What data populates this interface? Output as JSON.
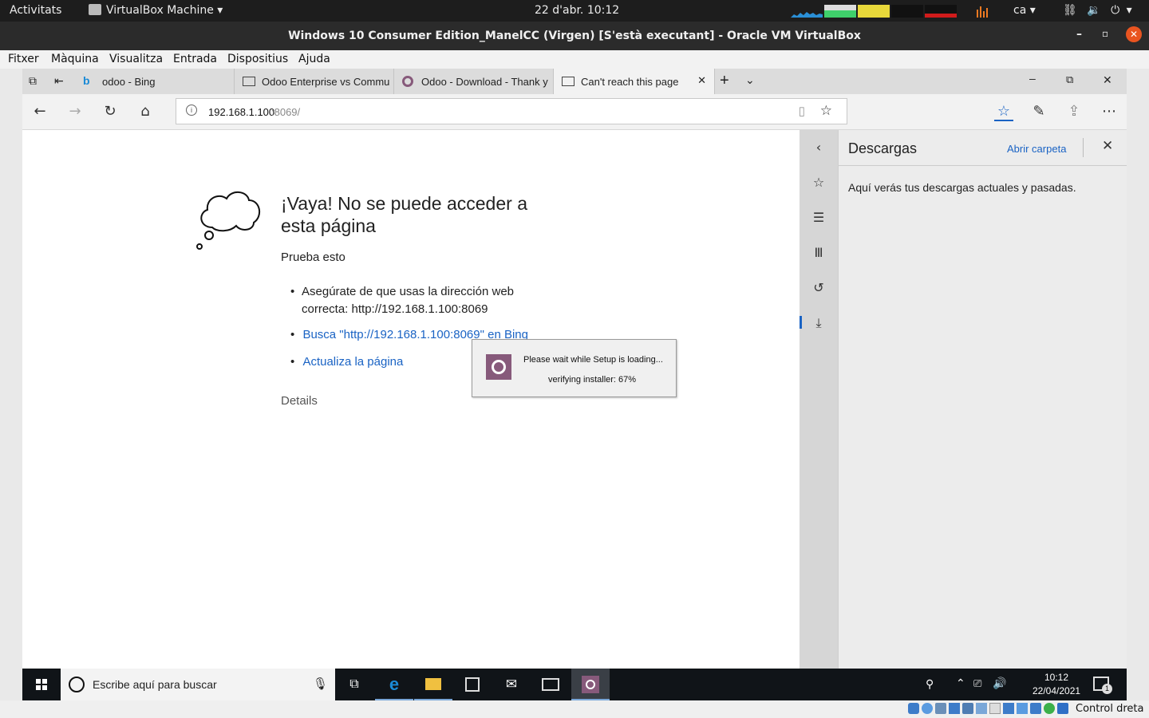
{
  "gnome": {
    "activities": "Activitats",
    "app_name": "VirtualBox Machine",
    "clock": "22 d'abr.  10:12",
    "lang": "ca"
  },
  "vbox": {
    "title": "Windows 10 Consumer Edition_ManelCC (Virgen) [S'està executant] - Oracle VM VirtualBox",
    "menu": [
      "Fitxer",
      "Màquina",
      "Visualitza",
      "Entrada",
      "Dispositius",
      "Ajuda"
    ],
    "status_key": "Control dreta"
  },
  "edge": {
    "tabs": [
      {
        "label": "odoo - Bing",
        "icon": "bing-icon"
      },
      {
        "label": "Odoo Enterprise vs Commu",
        "icon": "page-icon"
      },
      {
        "label": "Odoo - Download - Thank y",
        "icon": "odoo-icon"
      },
      {
        "label": "Can't reach this page",
        "icon": "page-icon"
      }
    ],
    "address_host": "192.168.1.100",
    "address_port": ":8069/"
  },
  "error_page": {
    "title": "¡Vaya! No se puede acceder a esta página",
    "try_this": "Prueba esto",
    "bullet1": "Asegúrate de que usas la dirección web correcta: http://192.168.1.100:8069",
    "bullet2": "Busca \"http://192.168.1.100:8069\" en Bing",
    "bullet3": "Actualiza la página",
    "details": "Details"
  },
  "downloads_panel": {
    "title": "Descargas",
    "open_folder": "Abrir carpeta",
    "empty_text": "Aquí verás tus descargas actuales y pasadas."
  },
  "setup_dialog": {
    "line1": "Please wait while Setup is loading...",
    "line2": "verifying installer: 67%"
  },
  "taskbar": {
    "search_placeholder": "Escribe aquí para buscar",
    "time": "10:12",
    "date": "22/04/2021",
    "notification_count": "1"
  },
  "colors": {
    "odoo_purple": "#875a7b",
    "edge_blue": "#1a63c4",
    "taskbar": "#101418"
  }
}
